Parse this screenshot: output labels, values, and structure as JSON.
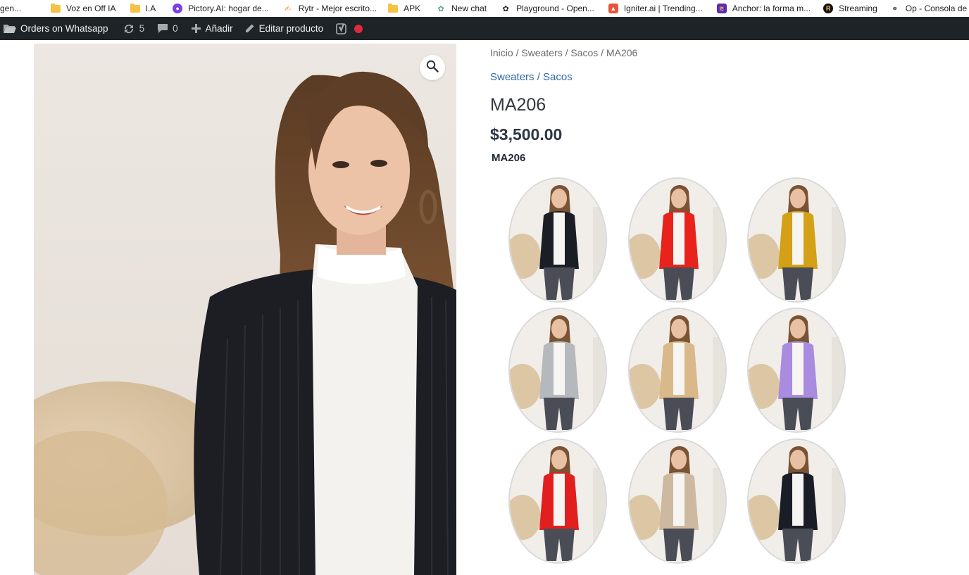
{
  "bookmarks": [
    {
      "label": "gen...",
      "icon": "none"
    },
    {
      "label": "Voz en Off IA",
      "icon": "folder-icon"
    },
    {
      "label": "I.A",
      "icon": "folder-icon"
    },
    {
      "label": "Pictory.AI: hogar de...",
      "icon": "octopus-icon"
    },
    {
      "label": "Rytr - Mejor escrito...",
      "icon": "pen-hand-icon"
    },
    {
      "label": "APK",
      "icon": "folder-icon"
    },
    {
      "label": "New chat",
      "icon": "openai-icon"
    },
    {
      "label": "Playground - Open...",
      "icon": "openai-icon"
    },
    {
      "label": "Igniter.ai | Trending...",
      "icon": "igniter-icon"
    },
    {
      "label": "Anchor: la forma m...",
      "icon": "anchor-icon"
    },
    {
      "label": "Streaming",
      "icon": "streaming-icon"
    },
    {
      "label": "Op - Consola de ad...",
      "icon": "op-icon"
    }
  ],
  "adminbar": {
    "orders_label": "Orders on Whatsapp",
    "updates_count": "5",
    "comments_count": "0",
    "add_label": "Añadir",
    "edit_label": "Editar producto"
  },
  "product": {
    "breadcrumb": "Inicio / Sweaters / Sacos / MA206",
    "categories": "Sweaters / Sacos",
    "title": "MA206",
    "price": "$3,500.00",
    "sku": "MA206"
  },
  "variant_colors": [
    "#1b1e24",
    "#e8231c",
    "#d4a017",
    "#b5b8bc",
    "#d9b98a",
    "#a98be0",
    "#e11f1f",
    "#cdb9a0",
    "#1a1d26"
  ],
  "colors": {
    "admin_bg": "#1d2327",
    "link": "#2e68a8",
    "record_dot": "#e0293e"
  }
}
